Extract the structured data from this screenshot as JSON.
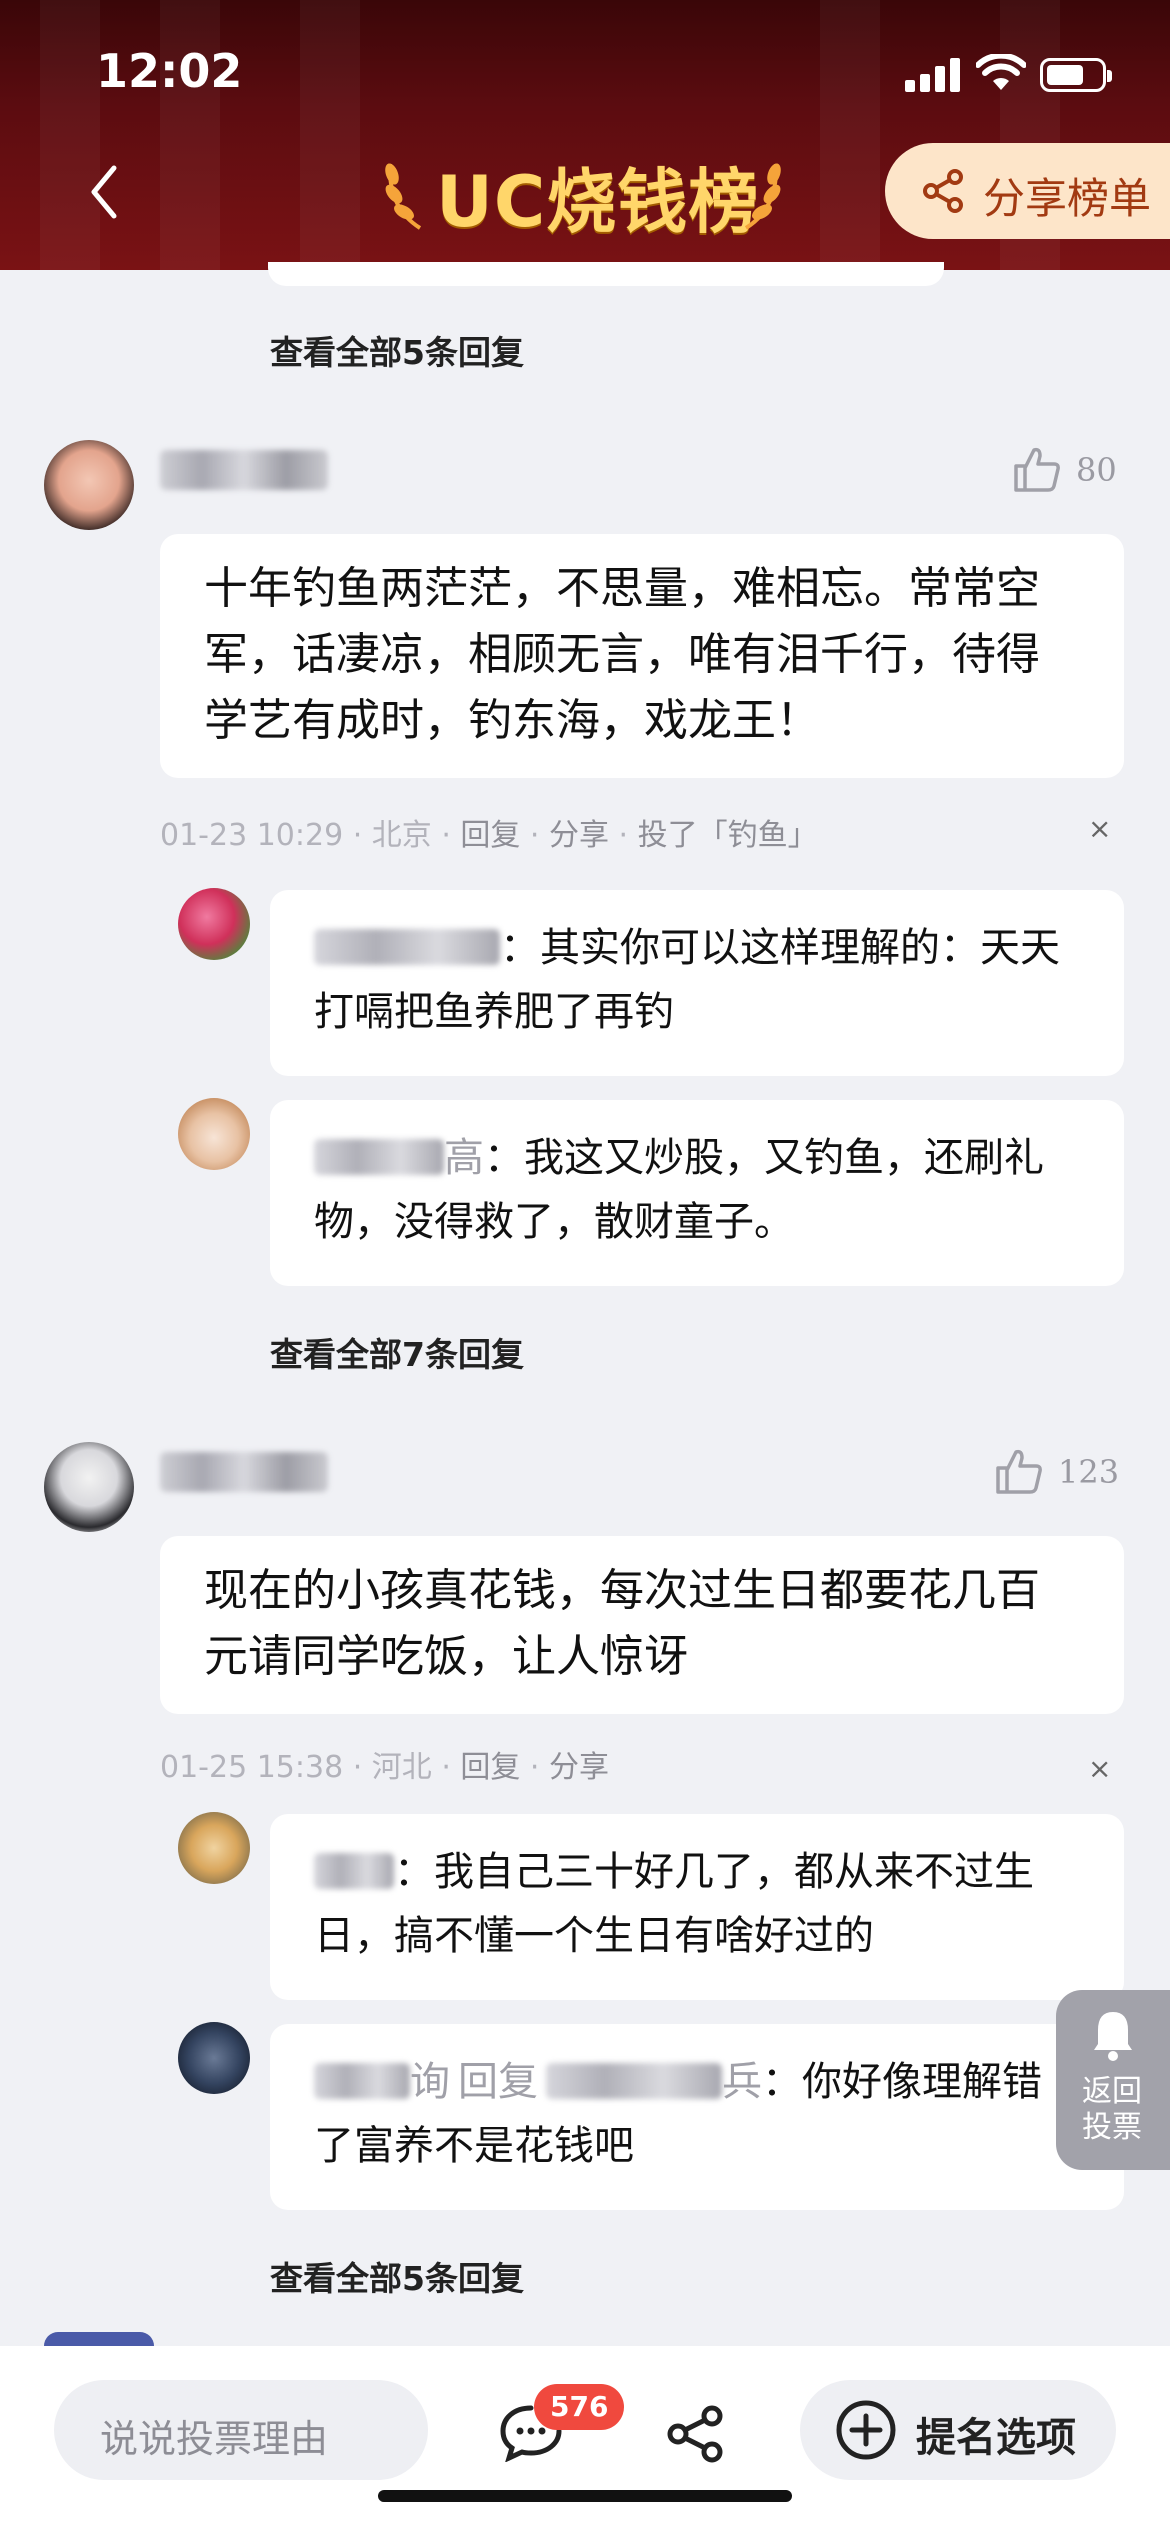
{
  "status_bar": {
    "time": "12:02"
  },
  "header": {
    "title": "UC烧钱榜",
    "share_label": "分享榜单"
  },
  "thread1": {
    "view_all": "查看全部5条回复"
  },
  "comment1": {
    "likes": "80",
    "text": "十年钓鱼两茫茫，不思量，难相忘。常常空军，话凄凉，相顾无言，唯有泪千行，待得学艺有成时，钓东海，戏龙王！",
    "time": "01-23 10:29",
    "location": "北京",
    "reply": "回复",
    "share": "分享",
    "vote": "投了「钓鱼」",
    "close": "×",
    "replies": [
      {
        "text": "：其实你可以这样理解的：天天打嗝把鱼养肥了再钓"
      },
      {
        "name_suffix": "高",
        "text": "：我这又炒股，又钓鱼，还刷礼物，没得救了，散财童子。"
      }
    ],
    "view_all": "查看全部7条回复"
  },
  "comment2": {
    "likes": "123",
    "text": "现在的小孩真花钱，每次过生日都要花几百元请同学吃饭，让人惊讶",
    "time": "01-25 15:38",
    "location": "河北",
    "reply": "回复",
    "share": "分享",
    "close": "×",
    "replies": [
      {
        "text": "：我自己三十好几了，都从来不过生日，搞不懂一个生日有啥好过的"
      },
      {
        "name_suffix": "询",
        "reply_word": "回复",
        "target_suffix": "兵",
        "text": "：你好像理解错了富养不是花钱吧"
      }
    ],
    "view_all": "查看全部5条回复"
  },
  "float_button": {
    "label": "返回投票"
  },
  "bottom_bar": {
    "placeholder": "说说投票理由",
    "comment_count": "576",
    "add_label": "提名选项"
  }
}
